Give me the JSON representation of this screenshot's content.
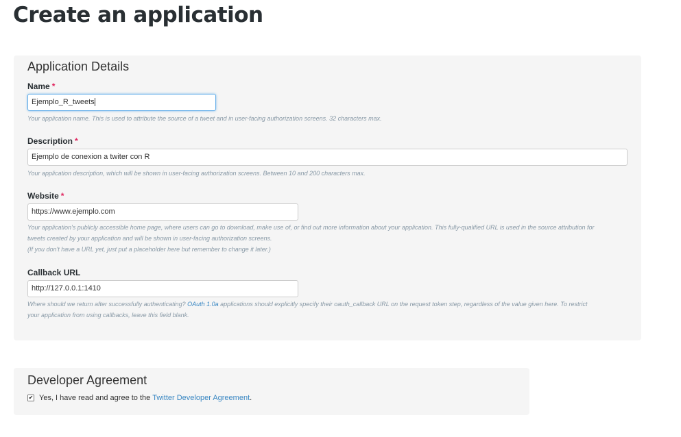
{
  "page_title": "Create an application",
  "details": {
    "heading": "Application Details",
    "required_marker": "*",
    "name": {
      "label": "Name",
      "value": "Ejemplo_R_tweets",
      "help": "Your application name. This is used to attribute the source of a tweet and in user-facing authorization screens. 32 characters max."
    },
    "description": {
      "label": "Description",
      "value": "Ejemplo de conexion a twiter con R",
      "help": "Your application description, which will be shown in user-facing authorization screens. Between 10 and 200 characters max."
    },
    "website": {
      "label": "Website",
      "value": "https://www.ejemplo.com",
      "help_line1": "Your application's publicly accessible home page, where users can go to download, make use of, or find out more information about your application. This fully-qualified URL is used in the source attribution for",
      "help_line2": "tweets created by your application and will be shown in user-facing authorization screens.",
      "help_line3": "(If you don't have a URL yet, just put a placeholder here but remember to change it later.)"
    },
    "callback": {
      "label": "Callback URL",
      "value": "http://127.0.0.1:1410",
      "help_pre": "Where should we return after successfully authenticating? ",
      "help_link": "OAuth 1.0a",
      "help_post": " applications should explicitly specify their oauth_callback URL on the request token step, regardless of the value given here. To restrict",
      "help_line2": "your application from using callbacks, leave this field blank."
    }
  },
  "agreement": {
    "heading": "Developer Agreement",
    "checked": true,
    "check_mark": "✔",
    "text": "Yes, I have read and agree to the",
    "link": "Twitter Developer Agreement",
    "suffix": "."
  }
}
